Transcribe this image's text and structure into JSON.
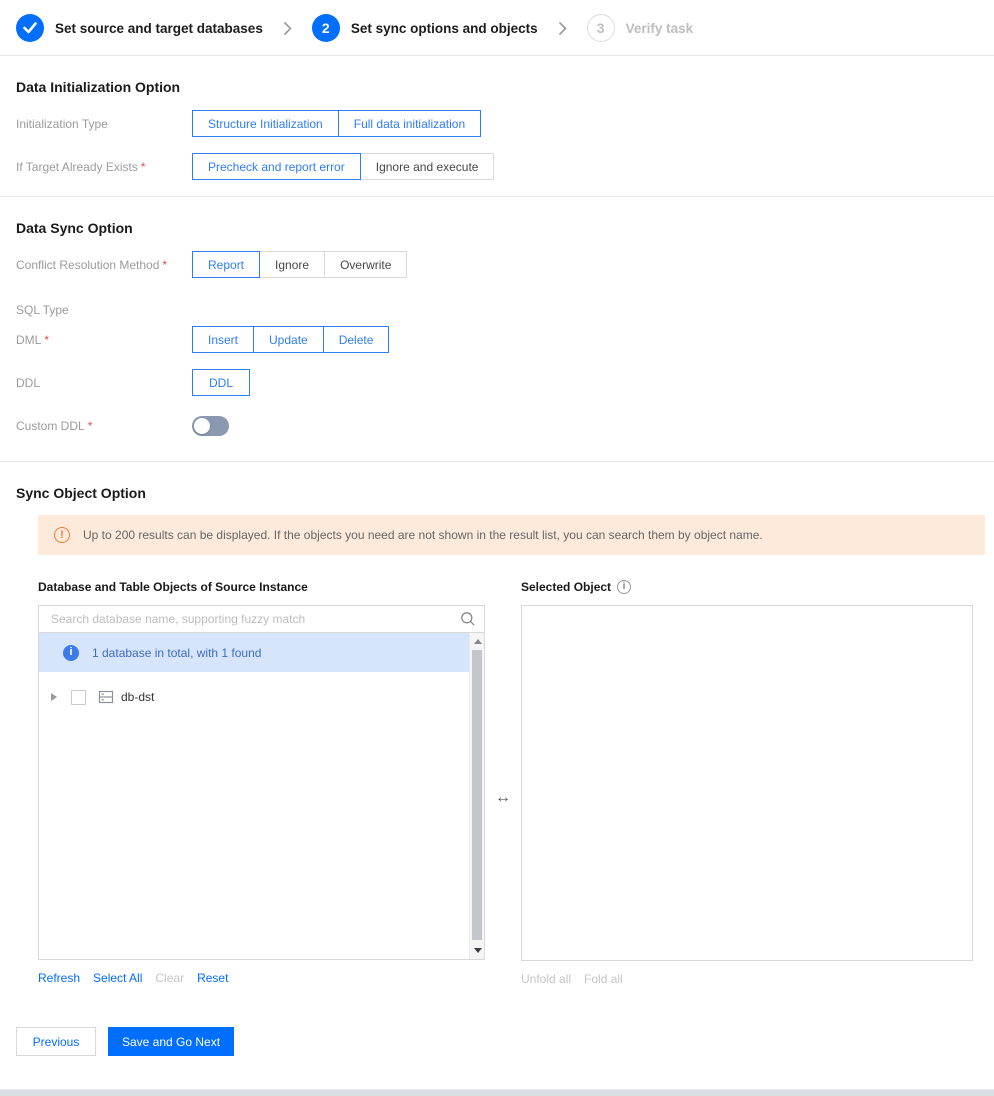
{
  "colors": {
    "primary": "#006eff",
    "selected_border": "#2f7cf6",
    "banner_bg": "#fdeadb",
    "info_bg": "#d6e5fb"
  },
  "required_marker": "*",
  "stepper": {
    "step1_label": "Set source and target databases",
    "step2_number": "2",
    "step2_label": "Set sync options and objects",
    "step3_number": "3",
    "step3_label": "Verify task"
  },
  "data_init": {
    "title": "Data Initialization Option",
    "init_type_label": "Initialization Type",
    "opt_structure": "Structure Initialization",
    "opt_full": "Full data initialization",
    "target_exists_label": "If Target Already Exists",
    "opt_precheck": "Precheck and report error",
    "opt_ignore_exec": "Ignore and execute"
  },
  "data_sync": {
    "title": "Data Sync Option",
    "conflict_label": "Conflict Resolution Method",
    "opt_report": "Report",
    "opt_ignore": "Ignore",
    "opt_overwrite": "Overwrite",
    "sql_type_label": "SQL Type",
    "dml_label": "DML",
    "opt_insert": "Insert",
    "opt_update": "Update",
    "opt_delete": "Delete",
    "ddl_label": "DDL",
    "opt_ddl": "DDL",
    "custom_ddl_label": "Custom DDL"
  },
  "sync_object": {
    "title": "Sync Object Option",
    "notice": "Up to 200 results can be displayed. If the objects you need are not shown in the result list, you can search them by object name.",
    "source_title": "Database and Table Objects of Source Instance",
    "search_placeholder": "Search database name, supporting fuzzy match",
    "result_info": "1 database in total, with 1 found",
    "db_name": "db-dst",
    "action_refresh": "Refresh",
    "action_select_all": "Select All",
    "action_clear": "Clear",
    "action_reset": "Reset",
    "selected_title": "Selected Object",
    "action_unfold": "Unfold all",
    "action_fold": "Fold all"
  },
  "footer": {
    "previous": "Previous",
    "save": "Save and Go Next"
  }
}
